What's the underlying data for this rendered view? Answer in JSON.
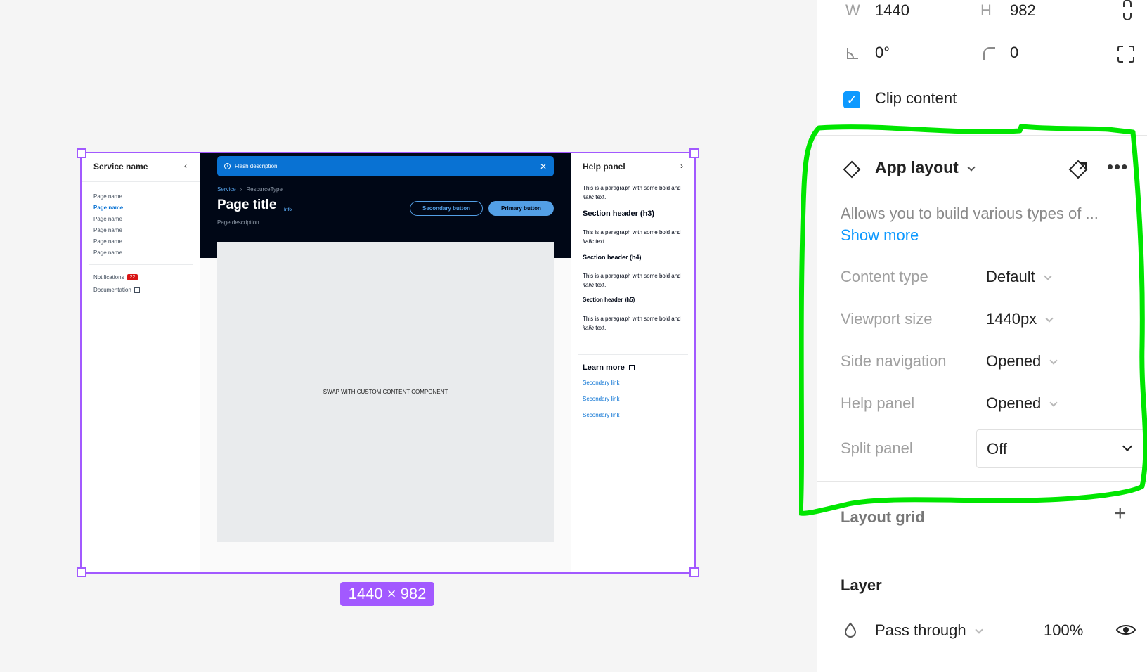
{
  "canvas": {
    "size_badge": "1440 × 982",
    "frame": {
      "sidenav": {
        "title": "Service name",
        "pages": [
          "Page name",
          "Page name",
          "Page name",
          "Page name",
          "Page name",
          "Page name"
        ],
        "active_index": 1,
        "notifications_label": "Notifications",
        "notifications_count": "22",
        "documentation_label": "Documentation"
      },
      "main": {
        "flash": "Flash description",
        "breadcrumb": [
          "Service",
          "ResourceType"
        ],
        "title": "Page title",
        "title_info": "Info",
        "description": "Page description",
        "secondary_button": "Secondary button",
        "primary_button": "Primary button",
        "content_placeholder": "SWAP WITH CUSTOM CONTENT COMPONENT"
      },
      "help": {
        "title": "Help panel",
        "paragraph_prefix": "This is a paragraph with some bold and ",
        "paragraph_italic": "italic",
        "paragraph_suffix": " text.",
        "h3": "Section header (h3)",
        "h4": "Section header (h4)",
        "h5": "Section header (h5)",
        "learn_more": "Learn more",
        "links": [
          "Secondary link",
          "Secondary link",
          "Secondary link"
        ]
      }
    }
  },
  "panel": {
    "w_label": "W",
    "w_value": "1440",
    "h_label": "H",
    "h_value": "982",
    "rotation": "0°",
    "radius": "0",
    "clip_content": "Clip content",
    "component": {
      "name": "App layout",
      "description": "Allows you to build various types of ...",
      "show_more": "Show more",
      "props": [
        {
          "label": "Content type",
          "value": "Default"
        },
        {
          "label": "Viewport size",
          "value": "1440px"
        },
        {
          "label": "Side navigation",
          "value": "Opened"
        },
        {
          "label": "Help panel",
          "value": "Opened"
        },
        {
          "label": "Split panel",
          "value": "Off"
        }
      ]
    },
    "layout_grid": "Layout grid",
    "layer": {
      "title": "Layer",
      "blend": "Pass through",
      "opacity": "100%"
    }
  },
  "colors": {
    "selection": "#a259ff",
    "highlight": "#00e600",
    "accent": "#0d99ff",
    "dark_header": "#000716"
  }
}
